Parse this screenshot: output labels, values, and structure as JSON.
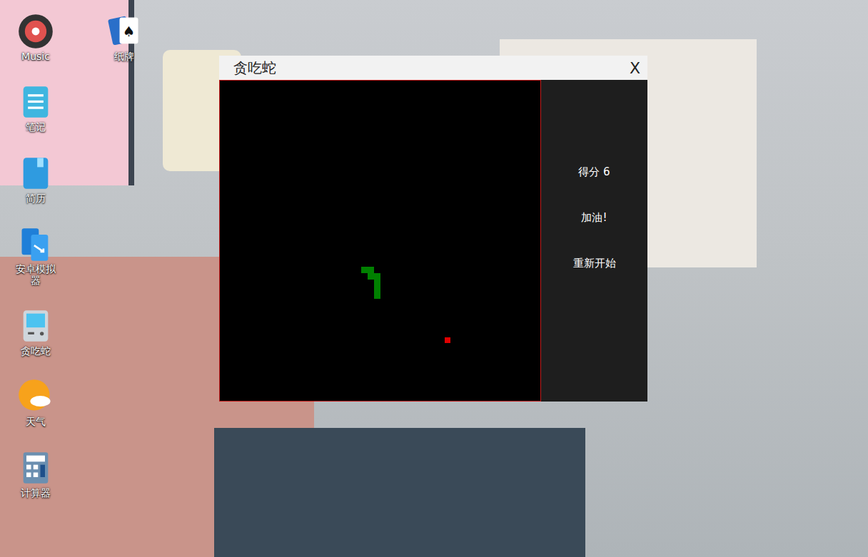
{
  "desktop": {
    "icons": [
      {
        "label": "Music",
        "kind": "music"
      },
      {
        "label": "纸牌",
        "kind": "cards"
      },
      {
        "label": "笔记",
        "kind": "notes"
      },
      {
        "label": "简历",
        "kind": "resume"
      },
      {
        "label": "安卓模拟器",
        "kind": "android"
      },
      {
        "label": "贪吃蛇",
        "kind": "game"
      },
      {
        "label": "天气",
        "kind": "weather"
      },
      {
        "label": "计算器",
        "kind": "calculator"
      }
    ]
  },
  "window": {
    "title": "贪吃蛇",
    "close": "X"
  },
  "board": {
    "cols": 50,
    "rows": 50,
    "snake": [
      [
        22,
        29
      ],
      [
        23,
        29
      ],
      [
        23,
        30
      ],
      [
        24,
        30
      ],
      [
        24,
        31
      ],
      [
        24,
        32
      ],
      [
        24,
        33
      ]
    ],
    "food": [
      35,
      40
    ]
  },
  "panel": {
    "score_label": "得分",
    "score": "6",
    "cheer": "加油!",
    "restart": "重新开始"
  }
}
